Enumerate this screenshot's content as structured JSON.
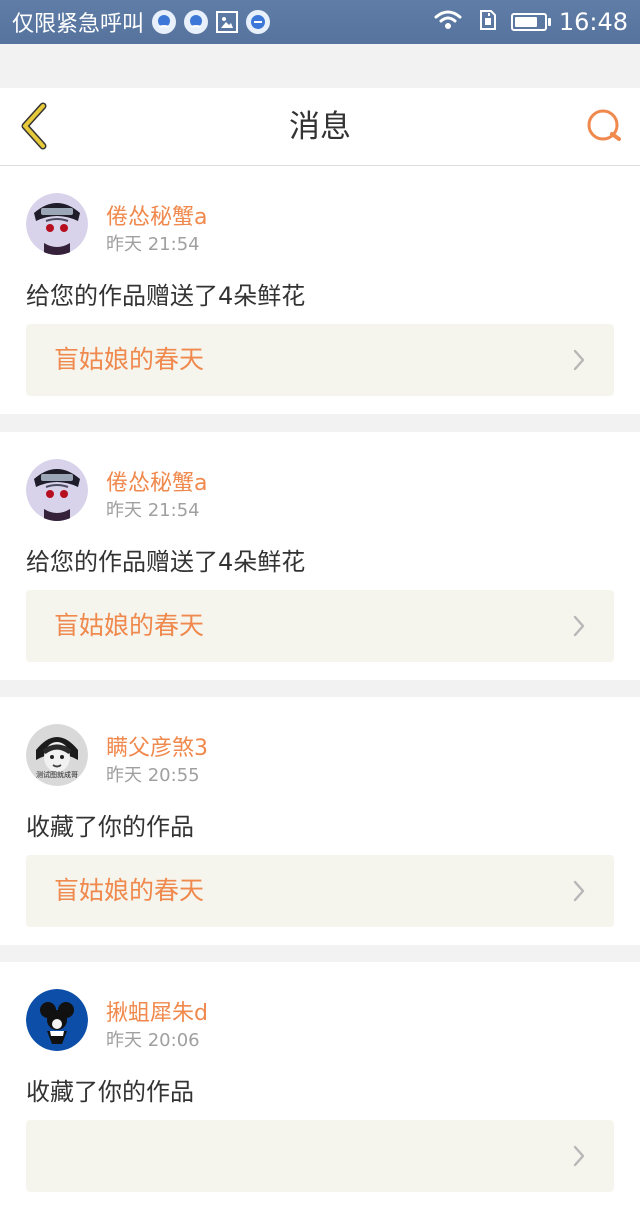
{
  "status_bar": {
    "carrier": "仅限紧急呼叫",
    "time": "16:48",
    "battery_level": 0.8
  },
  "nav": {
    "title": "消息"
  },
  "messages": [
    {
      "username": "倦怂秘蟹a",
      "time": "昨天 21:54",
      "action": "给您的作品赠送了4朵鲜花",
      "work_title": "盲姑娘的春天"
    },
    {
      "username": "倦怂秘蟹a",
      "time": "昨天 21:54",
      "action": "给您的作品赠送了4朵鲜花",
      "work_title": "盲姑娘的春天"
    },
    {
      "username": "瞒父彦煞3",
      "avatar_caption": "测试图就成哥",
      "time": "昨天 20:55",
      "action": "收藏了你的作品",
      "work_title": "盲姑娘的春天"
    },
    {
      "username": "揪蛆犀朱d",
      "time": "昨天 20:06",
      "action": "收藏了你的作品",
      "work_title": ""
    }
  ],
  "colors": {
    "accent": "#f0894d",
    "back_arrow": "#e5c93a",
    "status_bar": "#5f7da7"
  }
}
